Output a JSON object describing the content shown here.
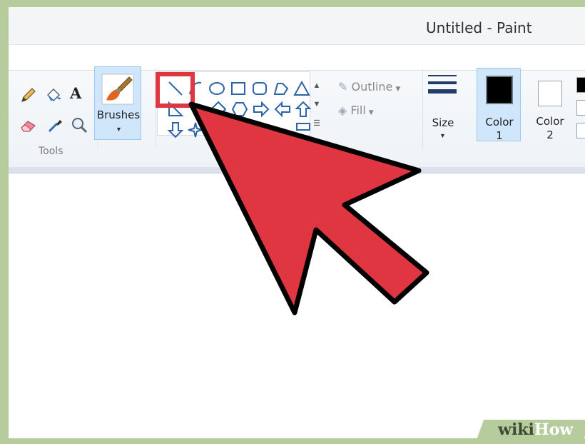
{
  "window": {
    "title": "Untitled - Paint"
  },
  "tools": {
    "group_label": "Tools",
    "items": [
      {
        "icon": "pencil-icon"
      },
      {
        "icon": "fill-bucket-icon"
      },
      {
        "icon": "text-icon",
        "glyph": "A"
      },
      {
        "icon": "eraser-icon"
      },
      {
        "icon": "color-picker-icon"
      },
      {
        "icon": "magnifier-icon"
      }
    ]
  },
  "brushes": {
    "label": "Brushes",
    "icon": "brush-icon"
  },
  "shapes": {
    "items": [
      "line-shape",
      "curve-shape",
      "oval-shape",
      "rectangle-shape",
      "rounded-rectangle-shape",
      "polygon-shape",
      "triangle-shape",
      "right-triangle-shape",
      "diamond-shape",
      "pentagon-shape",
      "hexagon-shape",
      "right-arrow-shape",
      "left-arrow-shape",
      "up-arrow-shape",
      "down-arrow-shape",
      "four-point-star-shape"
    ],
    "selected": "line-shape"
  },
  "outline": {
    "label": "Outline"
  },
  "fill": {
    "label": "Fill"
  },
  "size": {
    "label": "Size"
  },
  "color1": {
    "label_line1": "Color",
    "label_line2": "1",
    "value": "#000000"
  },
  "color2": {
    "label_line1": "Color",
    "label_line2": "2",
    "value": "#ffffff"
  },
  "watermark": {
    "wiki": "wiki",
    "how": "How"
  },
  "colors": {
    "accent_red": "#df3642",
    "shape_blue": "#2b64a8",
    "selection_blue": "#cfe6fb",
    "frame_green": "#b6cc9c"
  }
}
